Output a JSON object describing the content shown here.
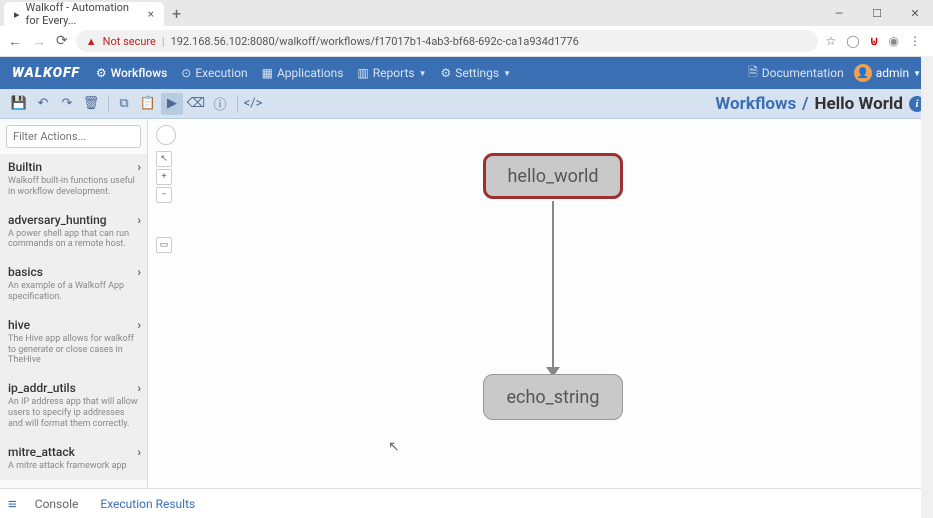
{
  "browser": {
    "tab_title": "Walkoff - Automation for Every...",
    "url": "192.168.56.102:8080/walkoff/workflows/f17017b1-4ab3-bf68-692c-ca1a934d1776",
    "security": "Not secure"
  },
  "app": {
    "brand": "WALKOFF",
    "nav": {
      "workflows": "Workflows",
      "execution": "Execution",
      "applications": "Applications",
      "reports": "Reports",
      "settings": "Settings"
    },
    "documentation": "Documentation",
    "user": "admin"
  },
  "breadcrumb": {
    "parent": "Workflows",
    "separator": "/",
    "current": "Hello World"
  },
  "filter_placeholder": "Filter Actions...",
  "actions": [
    {
      "name": "Builtin",
      "desc": "Walkoff built-in functions useful in workflow development."
    },
    {
      "name": "adversary_hunting",
      "desc": "A power shell app that can run commands on a remote host."
    },
    {
      "name": "basics",
      "desc": "An example of a Walkoff App specification."
    },
    {
      "name": "hive",
      "desc": "The Hive app allows for walkoff to generate or close cases in TheHive"
    },
    {
      "name": "ip_addr_utils",
      "desc": "An IP address app that will allow users to specify ip addresses and will format them correctly."
    },
    {
      "name": "mitre_attack",
      "desc": "A mitre attack framework app"
    }
  ],
  "nodes": {
    "hello_world": "hello_world",
    "echo_string": "echo_string"
  },
  "bottom_tabs": {
    "console": "Console",
    "execution_results": "Execution Results"
  }
}
